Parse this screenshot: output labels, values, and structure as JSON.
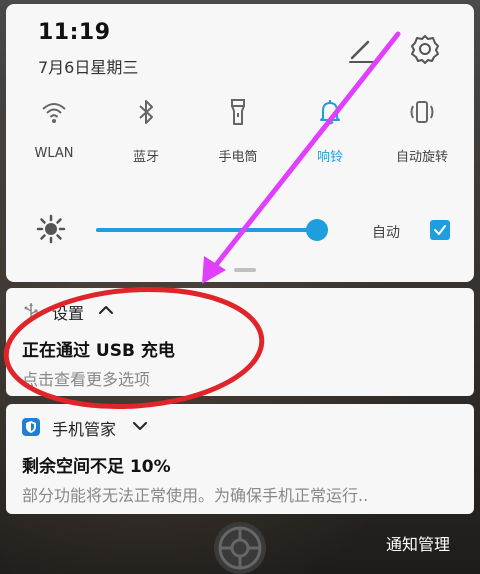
{
  "status": {
    "time": "11:19",
    "date": "7月6日星期三"
  },
  "header_actions": {
    "edit_icon": "pencil-edit-icon",
    "settings_icon": "gear-icon"
  },
  "quick_tiles": [
    {
      "label": "WLAN",
      "icon": "wifi-icon",
      "active": false
    },
    {
      "label": "蓝牙",
      "icon": "bluetooth-icon",
      "active": false
    },
    {
      "label": "手电筒",
      "icon": "flashlight-icon",
      "active": false
    },
    {
      "label": "响铃",
      "icon": "bell-icon",
      "active": true
    },
    {
      "label": "自动旋转",
      "icon": "auto-rotate-icon",
      "active": false
    }
  ],
  "brightness": {
    "level": 0.96,
    "auto_label": "自动",
    "auto_checked": true
  },
  "notifications": [
    {
      "app": "设置",
      "expanded": true,
      "title": "正在通过 USB 充电",
      "body": "点击查看更多选项"
    },
    {
      "app": "手机管家",
      "expanded": false,
      "title": "剩余空间不足 10%",
      "body": "部分功能将无法正常使用。为确保手机正常运行.."
    }
  ],
  "footer": {
    "manage_label": "通知管理"
  },
  "colors": {
    "accent": "#1e9ede",
    "annotation_arrow": "#e040fb",
    "annotation_circle": "#e0252a",
    "panel_bg": "#f7f7f7"
  }
}
